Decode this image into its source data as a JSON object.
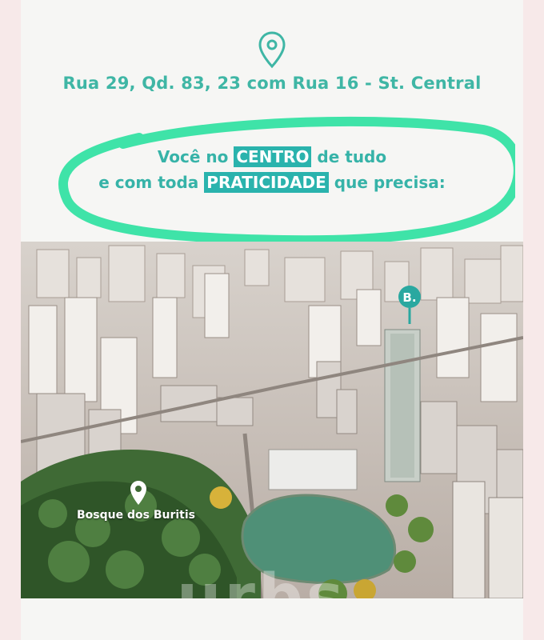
{
  "address": "Rua 29, Qd. 83, 23 com Rua 16 - St. Central",
  "headline": {
    "line1_pre": "Você no ",
    "line1_highlight": "CENTRO",
    "line1_post": " de tudo",
    "line2_pre": "e com toda ",
    "line2_highlight": "PRATICIDADE",
    "line2_post": " que precisa:"
  },
  "map": {
    "poi_label": "Bosque dos Buritis",
    "building_marker": "B.",
    "watermark": "urbs"
  },
  "colors": {
    "teal": "#3fb6a5",
    "highlight": "#2ab3ad",
    "circle": "#3fe3a8"
  },
  "icons": [
    "location-pin-icon",
    "location-pin-icon",
    "b-logo-marker-icon"
  ]
}
